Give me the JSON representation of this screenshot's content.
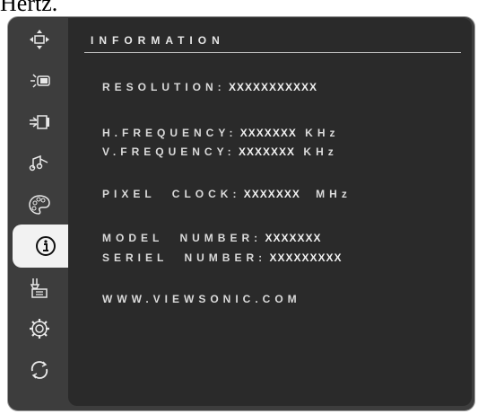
{
  "caption": "Hertz.",
  "sidebar": {
    "items": [
      {
        "icon": "move-position-icon"
      },
      {
        "icon": "brightness-icon"
      },
      {
        "icon": "input-source-icon"
      },
      {
        "icon": "audio-icon"
      },
      {
        "icon": "color-palette-icon"
      },
      {
        "icon": "information-icon",
        "active": true
      },
      {
        "icon": "manual-adjust-icon"
      },
      {
        "icon": "setup-gear-icon"
      },
      {
        "icon": "memory-recall-icon"
      }
    ]
  },
  "panel": {
    "title": "INFORMATION",
    "resolution": {
      "label": "RESOLUTION:",
      "value": "XXXXXXXXXXX"
    },
    "h_frequency": {
      "label": "H.FREQUENCY:",
      "value": "XXXXXXX",
      "unit": "KHz"
    },
    "v_frequency": {
      "label": "V.FREQUENCY:",
      "value": "XXXXXXX",
      "unit": "KHz"
    },
    "pixel_clock": {
      "label": "PIXEL CLOCK:",
      "value": "XXXXXXX",
      "unit": "MHz"
    },
    "model_number": {
      "label": "MODEL NUMBER:",
      "value": "XXXXXXX"
    },
    "serial_number": {
      "label": "SERIEL NUMBER:",
      "value": "XXXXXXXXX"
    },
    "website": "WWW.VIEWSONIC.COM"
  }
}
